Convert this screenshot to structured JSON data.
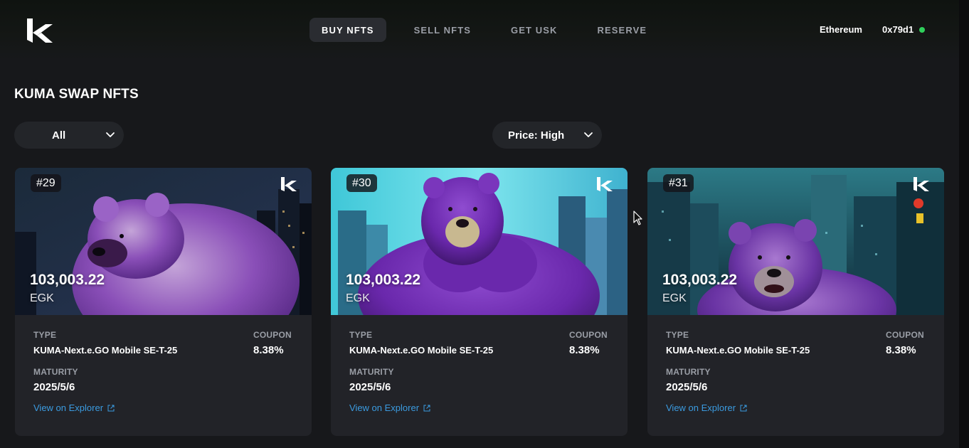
{
  "header": {
    "nav": [
      {
        "label": "BUY NFTS",
        "active": true
      },
      {
        "label": "SELL NFTS",
        "active": false
      },
      {
        "label": "GET USK",
        "active": false
      },
      {
        "label": "RESERVE",
        "active": false
      }
    ],
    "network": "Ethereum",
    "wallet": "0x79d1",
    "wallet_status_color": "#2fcf5b"
  },
  "page": {
    "title": "KUMA SWAP NFTS",
    "filter_value": "All",
    "sort_value": "Price: High"
  },
  "labels": {
    "type": "TYPE",
    "coupon": "COUPON",
    "maturity": "MATURITY",
    "explorer": "View on Explorer"
  },
  "cards": [
    {
      "id": "#29",
      "price": "103,003.22",
      "currency": "EGK",
      "type": "KUMA-Next.e.GO Mobile SE-T-25",
      "coupon": "8.38%",
      "maturity": "2025/5/6"
    },
    {
      "id": "#30",
      "price": "103,003.22",
      "currency": "EGK",
      "type": "KUMA-Next.e.GO Mobile SE-T-25",
      "coupon": "8.38%",
      "maturity": "2025/5/6"
    },
    {
      "id": "#31",
      "price": "103,003.22",
      "currency": "EGK",
      "type": "KUMA-Next.e.GO Mobile SE-T-25",
      "coupon": "8.38%",
      "maturity": "2025/5/6"
    }
  ],
  "colors": {
    "background": "#17181b",
    "card": "#222328",
    "link": "#3b9be0",
    "bear": "#6a2aa0"
  },
  "icons": [
    "kuma-logo-icon",
    "chevron-down-icon",
    "external-link-icon",
    "mouse-cursor-icon"
  ]
}
